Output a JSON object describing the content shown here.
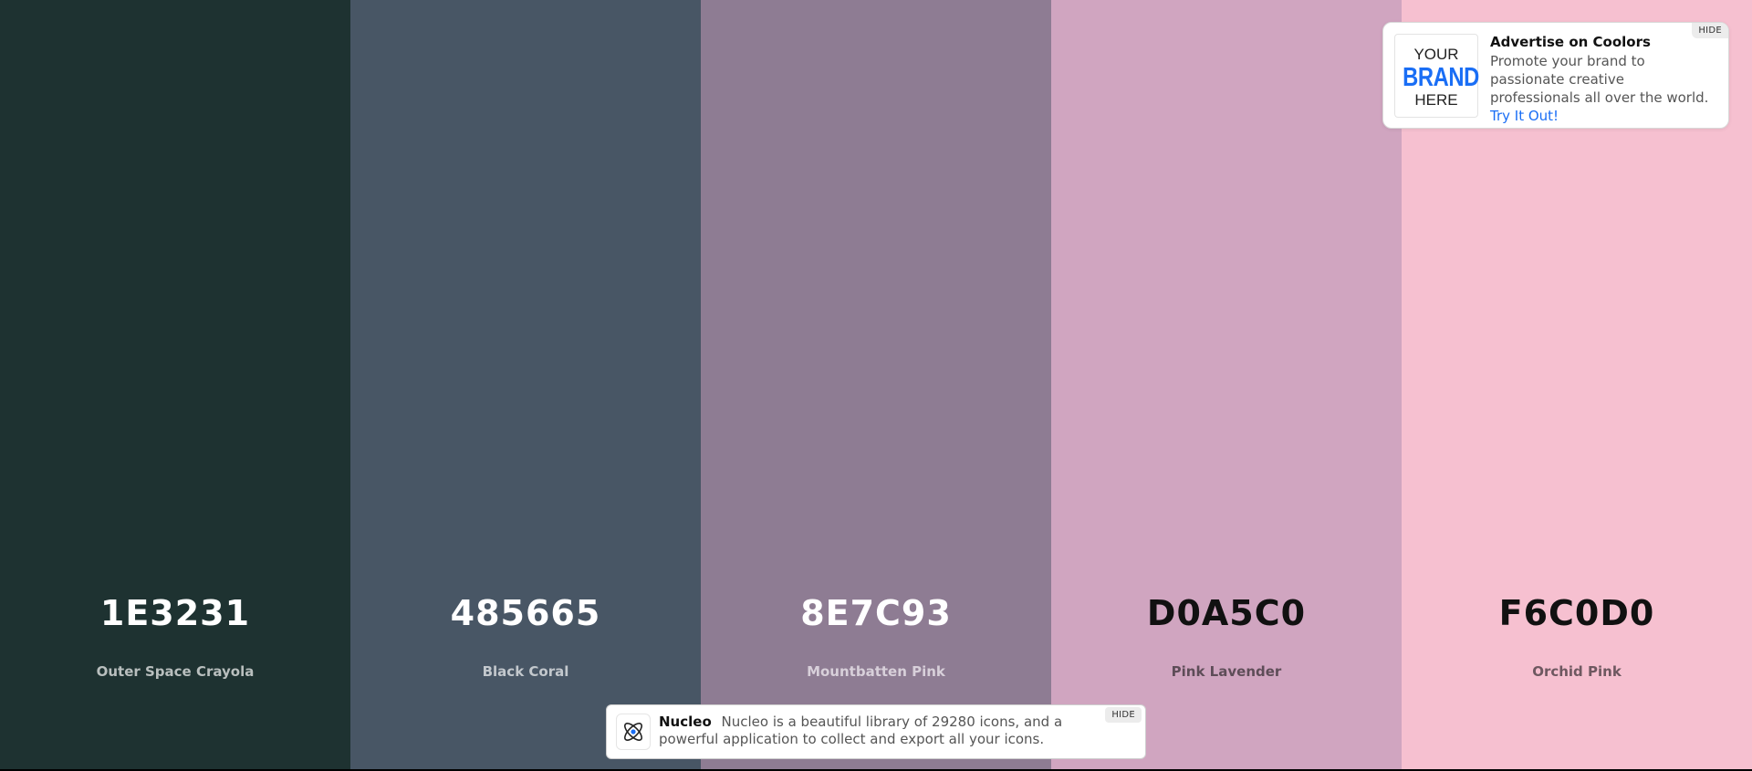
{
  "palette": [
    {
      "hex": "1E3231",
      "name": "Outer Space Crayola",
      "bg": "#1E3231",
      "hex_color": "#FFFFFF",
      "name_color": "#B9BFBE"
    },
    {
      "hex": "485665",
      "name": "Black Coral",
      "bg": "#485665",
      "hex_color": "#FFFFFF",
      "name_color": "#C3C8CD"
    },
    {
      "hex": "8E7C93",
      "name": "Mountbatten Pink",
      "bg": "#8E7C93",
      "hex_color": "#FFFFFF",
      "name_color": "#D8D0DA"
    },
    {
      "hex": "D0A5C0",
      "name": "Pink Lavender",
      "bg": "#D0A5C0",
      "hex_color": "#111111",
      "name_color": "#5E4D58"
    },
    {
      "hex": "F6C0D0",
      "name": "Orchid Pink",
      "bg": "#F6C0D0",
      "hex_color": "#111111",
      "name_color": "#6E5860"
    }
  ],
  "ad": {
    "logo_line1": "YOUR",
    "logo_line2": "BRAND",
    "logo_line3": "HERE",
    "title": "Advertise on Coolors",
    "description": "Promote your brand to passionate creative professionals all over the world.",
    "link": "Try It Out!",
    "hide_label": "HIDE",
    "link_color": "#1A6EF5"
  },
  "nucleo": {
    "brand": "Nucleo",
    "description": "Nucleo is a beautiful library of 29280 icons, and a powerful application to collect and export all your icons.",
    "hide_label": "HIDE",
    "icon": "atom-icon"
  }
}
